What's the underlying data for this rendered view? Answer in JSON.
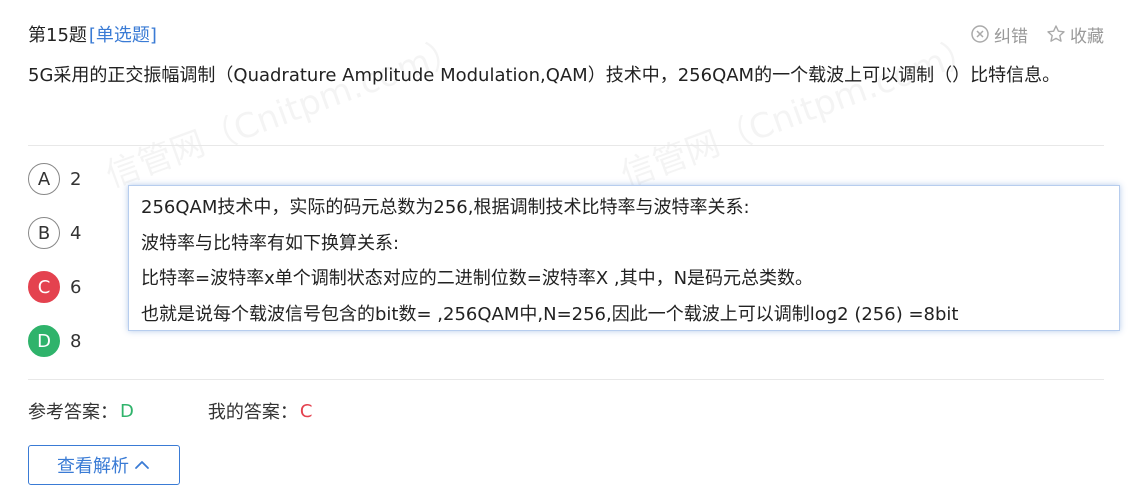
{
  "header": {
    "number_label": "第15题",
    "type_label": "[单选题]",
    "report_label": "纠错",
    "report_icon": "close-circle-icon",
    "favorite_label": "收藏",
    "favorite_icon": "star-icon"
  },
  "question": {
    "text": "5G采用的正交振幅调制（Quadrature Amplitude Modulation,QAM）技术中，256QAM的一个载波上可以调制（）比特信息。"
  },
  "options": [
    {
      "letter": "A",
      "text": "2",
      "state": "normal"
    },
    {
      "letter": "B",
      "text": "4",
      "state": "normal"
    },
    {
      "letter": "C",
      "text": "6",
      "state": "wrong"
    },
    {
      "letter": "D",
      "text": "8",
      "state": "correct"
    }
  ],
  "explanation": {
    "lines": [
      "256QAM技术中，实际的码元总数为256,根据调制技术比特率与波特率关系:",
      "波特率与比特率有如下换算关系:",
      "比特率=波特率x单个调制状态对应的二进制位数=波特率X  ,其中，N是码元总类数。",
      "也就是说每个载波信号包含的bit数=  ,256QAM中,N=256,因此一个载波上可以调制log2 (256) =8bit"
    ]
  },
  "answers": {
    "reference_label": "参考答案：",
    "reference_value": "D",
    "mine_label": "我的答案：",
    "mine_value": "C"
  },
  "analysis_button": {
    "label": "查看解析",
    "icon": "chevron-up-icon"
  },
  "watermark": {
    "text": "信管网（Cnitpm.com）"
  },
  "colors": {
    "accent": "#3a7bd5",
    "correct": "#2fb36b",
    "wrong": "#e4424f"
  }
}
